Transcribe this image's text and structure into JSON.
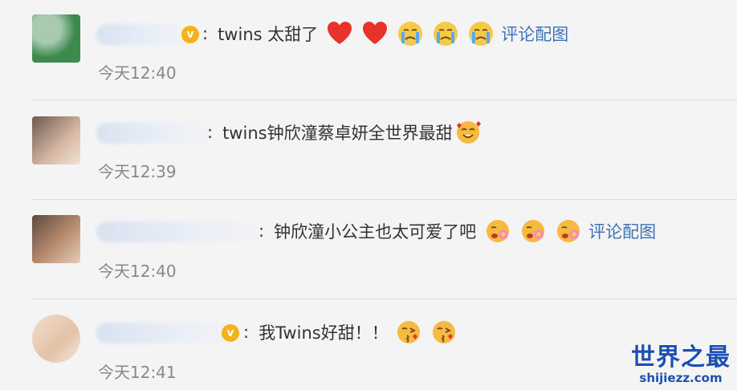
{
  "comments": [
    {
      "text": "twins 太甜了",
      "colon": ":",
      "emojis": [
        "red-heart",
        "red-heart",
        "crying-face",
        "crying-face",
        "crying-face"
      ],
      "link": "评论配图",
      "time": "今天12:40"
    },
    {
      "text": "twins钟欣潼蔡卓妍全世界最甜",
      "colon": ":",
      "emojis": [
        "smiling-face-with-hearts"
      ],
      "link": "",
      "time": "今天12:39"
    },
    {
      "text": "钟欣潼小公主也太可爱了吧",
      "colon": ":",
      "emojis": [
        "flower-face",
        "flower-face",
        "flower-face"
      ],
      "link": "评论配图",
      "time": "今天12:40"
    },
    {
      "text": "我Twins好甜！！",
      "colon": ":",
      "emojis": [
        "kissing-face",
        "kissing-face"
      ],
      "link": "",
      "time": "今天12:41"
    }
  ],
  "watermark": {
    "title": "世界之最",
    "domain": "shijiezz.com"
  },
  "colors": {
    "link": "#3f72b8",
    "time": "#888888",
    "text": "#333333",
    "background": "#f4f4f5",
    "watermark": "#1d4fb3"
  }
}
